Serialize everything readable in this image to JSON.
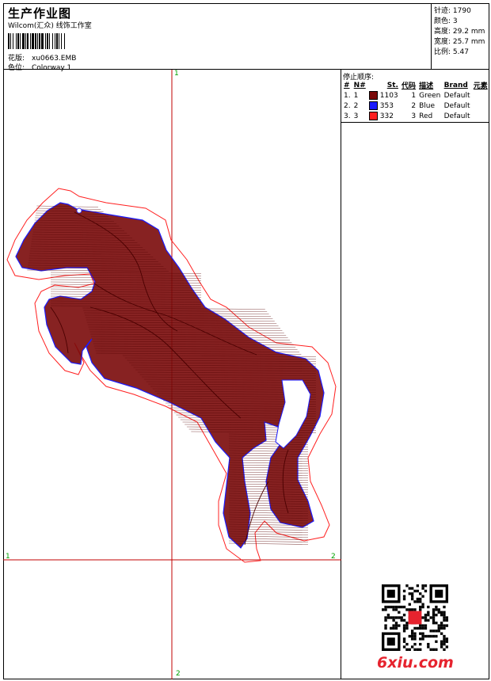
{
  "header": {
    "title": "生产作业图",
    "subtitle": "Wilcom(汇众) 线饰工作室",
    "design_label": "花版:",
    "design_value": "xu0663.EMB",
    "colorway_label": "色位:",
    "colorway_value": "Colorway 1"
  },
  "stats": [
    {
      "label": "针迹:",
      "value": "1790"
    },
    {
      "label": "颜色:",
      "value": "3"
    },
    {
      "label": "高度:",
      "value": "29.2 mm"
    },
    {
      "label": "宽度:",
      "value": "25.7 mm"
    },
    {
      "label": "比例:",
      "value": "5.47"
    }
  ],
  "stop_sequence": {
    "title": "停止顺序:",
    "columns": [
      "#",
      "N#",
      "St.",
      "代码",
      "描述",
      "Brand",
      "元素"
    ],
    "rows": [
      {
        "idx": "1.",
        "n": "1",
        "color": "#7a0a0a",
        "st": "1103",
        "code": "1",
        "desc": "Green",
        "brand": "Default"
      },
      {
        "idx": "2.",
        "n": "2",
        "color": "#1a1aff",
        "st": "353",
        "code": "2",
        "desc": "Blue",
        "brand": "Default"
      },
      {
        "idx": "3.",
        "n": "3",
        "color": "#ff2020",
        "st": "332",
        "code": "3",
        "desc": "Red",
        "brand": "Default"
      }
    ]
  },
  "axes": {
    "top_label": "1",
    "bottom_label": "2",
    "left_label": "1",
    "right_label": "2"
  },
  "colors": {
    "fill_thread": "#7a0a0a",
    "outline_blue": "#1a1aff",
    "outline_red": "#ff2020",
    "axis_red": "#c00000",
    "axis_green": "#00a000",
    "brand_red": "#e6232e"
  },
  "watermark": {
    "text": "6xiu.com"
  }
}
